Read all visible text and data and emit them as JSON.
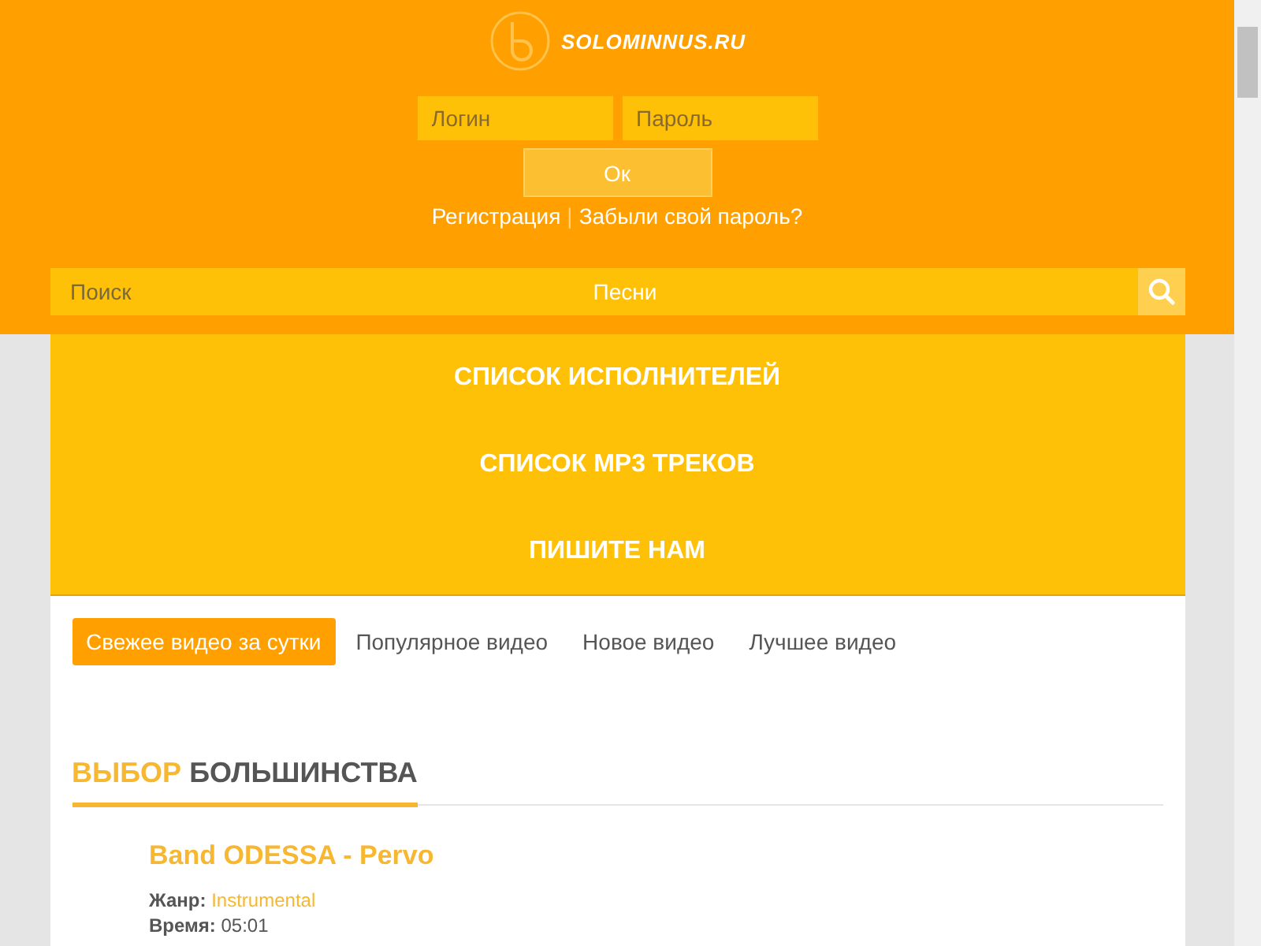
{
  "site": {
    "logo_text": "SOLOMINNUS.RU"
  },
  "login": {
    "login_placeholder": "Логин",
    "password_placeholder": "Пароль",
    "submit": "Ок",
    "register": "Регистрация",
    "separator": "|",
    "forgot": "Забыли свой пароль?"
  },
  "search": {
    "placeholder": "Поиск",
    "category": "Песни"
  },
  "menu": [
    {
      "label": "СПИСОК ИСПОЛНИТЕЛЕЙ"
    },
    {
      "label": "СПИСОК MP3 ТРЕКОВ"
    },
    {
      "label": "ПИШИТЕ НАМ"
    }
  ],
  "tabs": [
    {
      "label": "Свежее видео за сутки",
      "selected": true
    },
    {
      "label": "Популярное видео",
      "selected": false
    },
    {
      "label": "Новое видео",
      "selected": false
    },
    {
      "label": "Лучшее видео",
      "selected": false
    }
  ],
  "section": {
    "title_accent": "ВЫБОР",
    "title_rest": "БОЛЬШИНСТВА"
  },
  "track": {
    "title": "Band ODESSA - Pervo",
    "genre_label": "Жанр:",
    "genre": "Instrumental",
    "time_label": "Время:",
    "time": "05:01"
  }
}
